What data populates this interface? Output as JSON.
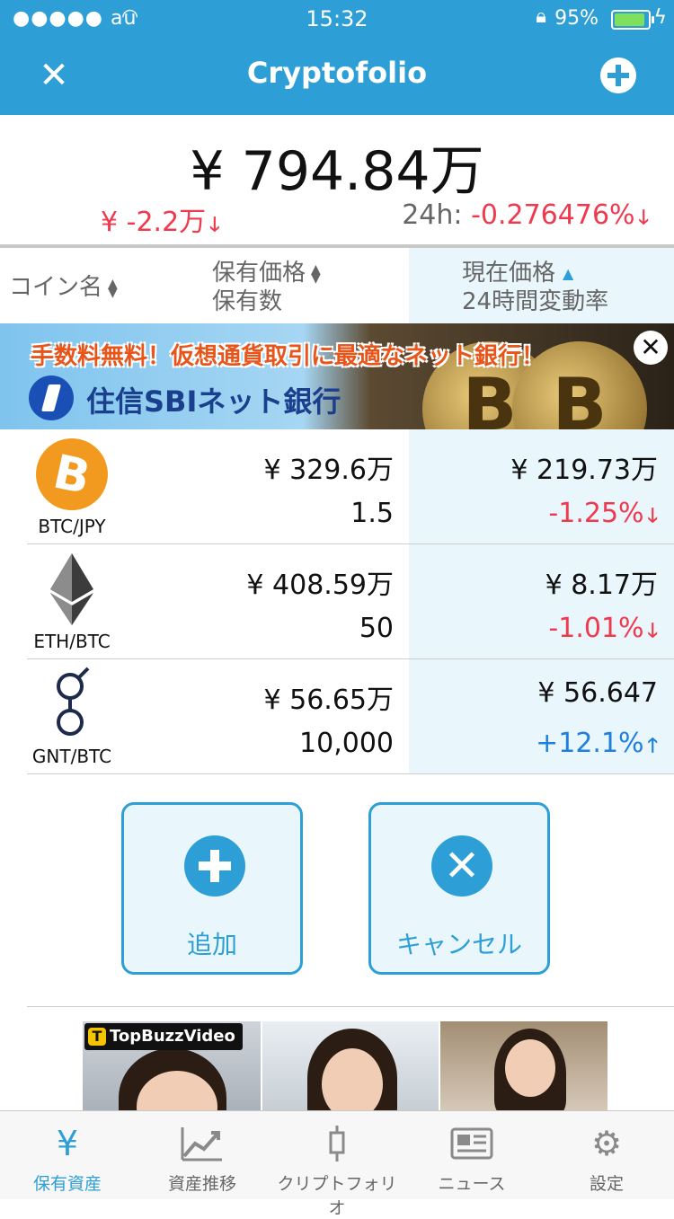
{
  "status_bar": {
    "carrier": "●●●●● au",
    "time": "15:32",
    "battery": "95%",
    "battery_level": 0.95
  },
  "nav": {
    "title": "Cryptofolio",
    "close_icon": "close-icon",
    "add_icon": "plus-circle-icon",
    "brand_color": "#2d9fd6"
  },
  "summary": {
    "total": "¥ 794.84万",
    "change_value": "¥ -2.2万",
    "change_24h_label": "24h:",
    "change_24h_value": "-0.276476%",
    "down_color": "#f0394e",
    "up_color": "#1e7fe0"
  },
  "columns": {
    "coin_name": "コイン名",
    "holding_value": "保有価格",
    "holding_qty": "保有数",
    "current_price": "現在価格",
    "change_24h": "24時間変動率"
  },
  "banner": {
    "headline": "手数料無料！仮想通貨取引に最適なネット銀行！",
    "brand": "住信SBIネット銀行",
    "close_label": "✕"
  },
  "holdings": [
    {
      "symbol": "BTC/JPY",
      "icon": "bitcoin-icon",
      "held_value": "¥ 329.6万",
      "quantity": "1.5",
      "price": "¥ 219.73万",
      "change": "-1.25%",
      "direction": "down"
    },
    {
      "symbol": "ETH/BTC",
      "icon": "ethereum-icon",
      "held_value": "¥ 408.59万",
      "quantity": "50",
      "price": "¥ 8.17万",
      "change": "-1.01%",
      "direction": "down"
    },
    {
      "symbol": "GNT/BTC",
      "icon": "golem-icon",
      "held_value": "¥ 56.65万",
      "quantity": "10,000",
      "price": "¥ 56.647",
      "change": "+12.1%",
      "direction": "up"
    }
  ],
  "actions": {
    "add_label": "追加",
    "cancel_label": "キャンセル"
  },
  "ad": {
    "brand": "TopBuzzVideo"
  },
  "tabbar": [
    {
      "label": "保有資産",
      "icon": "yen-icon",
      "active": true
    },
    {
      "label": "資産推移",
      "icon": "chart-icon",
      "active": false
    },
    {
      "label": "クリプトフォリオ",
      "icon": "candlestick-icon",
      "active": false
    },
    {
      "label": "ニュース",
      "icon": "newspaper-icon",
      "active": false
    },
    {
      "label": "設定",
      "icon": "gear-icon",
      "active": false
    }
  ]
}
